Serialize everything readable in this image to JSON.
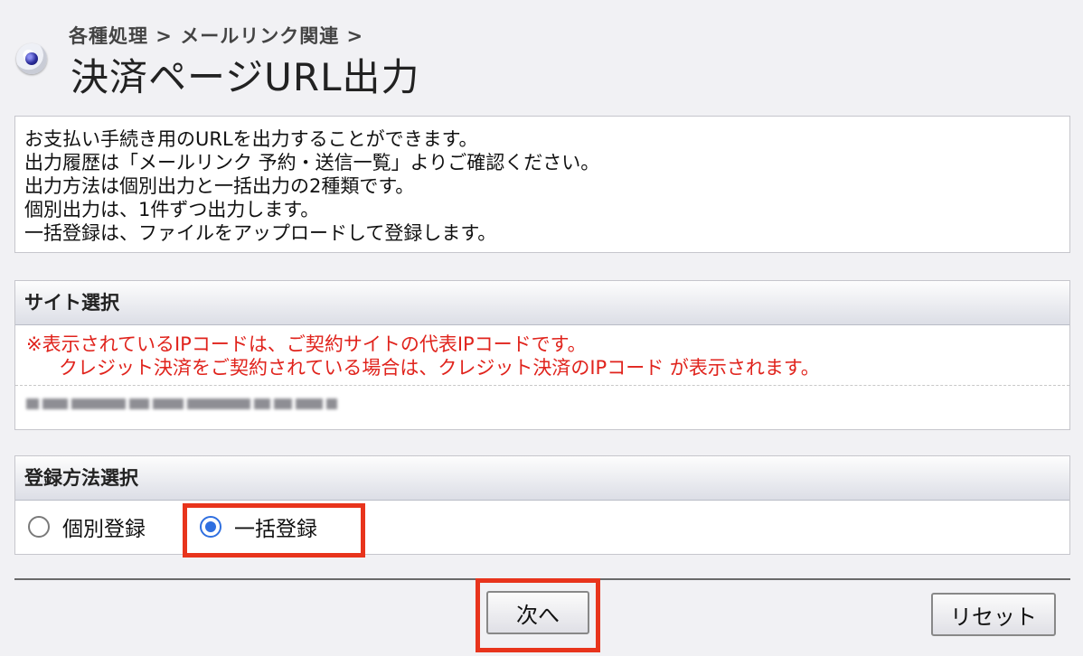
{
  "header": {
    "breadcrumb": "各種処理 > メールリンク関連 >",
    "title": "決済ページURL出力"
  },
  "description": {
    "lines": [
      "お支払い手続き用のURLを出力することができます。",
      "出力履歴は「メールリンク 予約・送信一覧」よりご確認ください。",
      "出力方法は個別出力と一括出力の2種類です。",
      "個別出力は、1件ずつ出力します。",
      "一括登録は、ファイルをアップロードして登録します。"
    ]
  },
  "site_selection": {
    "heading": "サイト選択",
    "notes": [
      "※表示されているIPコードは、ご契約サイトの代表IPコードです。",
      "クレジット決済をご契約されている場合は、クレジット決済のIPコード が表示されます。"
    ]
  },
  "method_selection": {
    "heading": "登録方法選択",
    "options": [
      {
        "label": "個別登録",
        "checked": false
      },
      {
        "label": "一括登録",
        "checked": true
      }
    ]
  },
  "buttons": {
    "next": "次へ",
    "reset": "リセット"
  },
  "colors": {
    "highlight": "#e8341c",
    "note_text": "#e0231c",
    "radio_selected": "#2f6fe0"
  }
}
